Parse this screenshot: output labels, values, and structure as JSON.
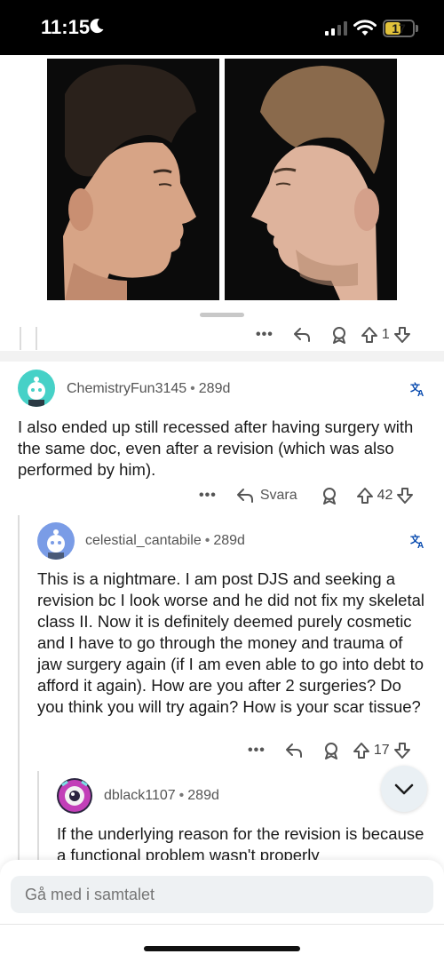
{
  "status_bar": {
    "time": "11:15",
    "battery_level": "17",
    "icons": [
      "moon-icon",
      "signal-icon",
      "wifi-icon",
      "battery-icon"
    ]
  },
  "top_comment_actions": {
    "upvote_count": "1"
  },
  "comments": [
    {
      "username": "ChemistryFun3145",
      "age": "289d",
      "text": "I also ended up still recessed after having surgery with the same doc, even after a revision (which was also performed by him).",
      "reply_label": "Svara",
      "upvote_count": "42",
      "avatar_color": "#46d1c7"
    },
    {
      "username": "celestial_cantabile",
      "age": "289d",
      "text": "This is a nightmare. I am post DJS and seeking a revision bc I look worse and he did not fix my skeletal class II. Now it is definitely deemed purely cosmetic and I have to go through the money and trauma of jaw surgery again (if I am even able to go into debt to afford it again). How are you after 2 surgeries? Do you think you will try again? How is your scar tissue?",
      "upvote_count": "17",
      "avatar_color": "#7a9ce6"
    },
    {
      "username": "dblack1107",
      "age": "289d",
      "text": "If the underlying reason for the revision is because a functional problem wasn't properly",
      "avatar_color": "#c23fb8"
    }
  ],
  "separator": "•",
  "join_input": {
    "placeholder": "Gå med i samtalet"
  },
  "colors": {
    "accent_link": "#0045ac",
    "icon_gray": "#555555"
  }
}
